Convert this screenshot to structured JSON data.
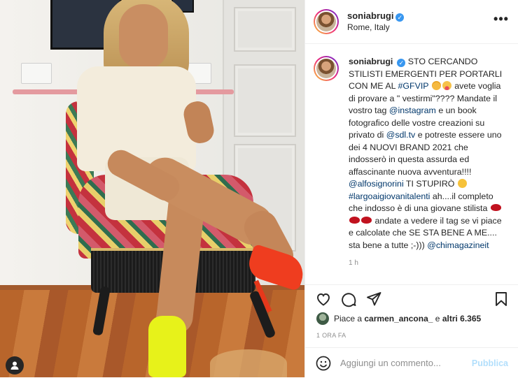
{
  "post": {
    "username": "soniabrugi",
    "location": "Rome, Italy",
    "more_label": "•••",
    "verified_mark": "✓"
  },
  "caption": {
    "username": "soniabrugi",
    "p1": "STO CERCANDO STILISTI EMERGENTI PER PORTARLI CON ME AL",
    "tag_gfvip": "#GFVIP",
    "p2": "avete voglia di provare a \" vestirmi\"???? Mandate il vostro tag",
    "mention_instagram": "@instagram",
    "p3": "e un book fotografico delle vostre creazioni su privato di",
    "mention_sdl": "@sdl.tv",
    "p4": "e potreste essere uno dei 4 NUOVI BRAND 2021 che indosserò in questa assurda ed affascinante nuova avventura!!!!",
    "mention_alfo": "@alfosignorini",
    "p5": "TI STUPIRÒ",
    "tag_largo": "#largoaigiovanitalenti",
    "p6": "ah....il completo che indosso è di una giovane stilista",
    "p7": "andate a vedere il tag se vi piace e calcolate che SE STA BENE A ME.... sta bene a tutte ;-)))",
    "mention_chi": "@chimagazineit",
    "time": "1 h"
  },
  "likes": {
    "prefix": "Piace a",
    "user": "carmen_ancona_",
    "middle": "e",
    "others": "altri 6.365"
  },
  "date": "1 ORA FA",
  "composer": {
    "placeholder": "Aggiungi un commento...",
    "publish_label": "Pubblica"
  },
  "icons": {
    "like": "heart-icon",
    "comment": "comment-icon",
    "share": "paper-plane-icon",
    "save": "bookmark-icon",
    "emoji": "smile-icon",
    "tags": "user-tag-icon"
  },
  "colors": {
    "link": "#00376b",
    "verified": "#3897f0",
    "publish_disabled": "#b2dffc",
    "muted": "#8e8e8e"
  }
}
